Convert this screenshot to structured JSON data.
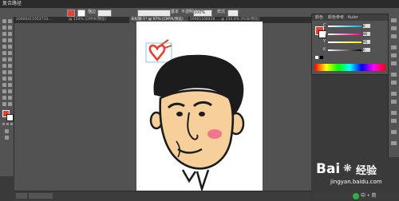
{
  "app": {
    "menu_title": "复合路径"
  },
  "controlbar": {
    "stroke_label": "描边",
    "style_label": "基本",
    "opacity_label": "不透明度",
    "opacity_value": "100%",
    "style2_label": "样式"
  },
  "tabs": [
    {
      "label": "20000411053733…"
    },
    {
      "label": "@ 150% (CMYK/预览)"
    },
    {
      "label": "未标题-1* @ 97% (CMYK/预览)",
      "active": true
    },
    {
      "label": "20001108428 … @ 234.4% (RGB/预览)"
    }
  ],
  "color_panel": {
    "tabs": [
      "颜色",
      "颜色参考",
      "Kuler"
    ],
    "channels": [
      {
        "name": "C",
        "value": "0"
      },
      {
        "name": "M",
        "value": "96"
      },
      {
        "name": "Y",
        "value": "95"
      },
      {
        "name": "K",
        "value": "0"
      }
    ]
  },
  "colors": {
    "fill": "#e8402c",
    "stroke": "#ffffff",
    "accent": "#e8402c"
  },
  "watermark": {
    "brand": "Bai",
    "brand2": "经验",
    "domain": "jingyan.baidu.com"
  },
  "bottom": {
    "label": "中 • 简"
  }
}
